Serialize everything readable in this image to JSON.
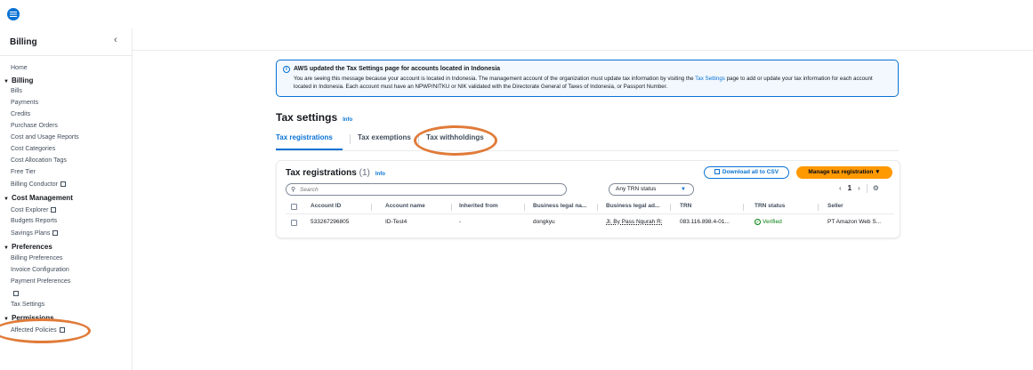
{
  "sidebar": {
    "title": "Billing",
    "collapse_glyph": "‹",
    "items": [
      {
        "key": "home",
        "label": "Home",
        "kind": "item"
      },
      {
        "key": "billing",
        "label": "Billing",
        "kind": "section"
      },
      {
        "key": "bills",
        "label": "Bills",
        "kind": "item"
      },
      {
        "key": "payments",
        "label": "Payments",
        "kind": "item"
      },
      {
        "key": "credits",
        "label": "Credits",
        "kind": "item"
      },
      {
        "key": "purchase-orders",
        "label": "Purchase Orders",
        "kind": "item"
      },
      {
        "key": "cost-usage",
        "label": "Cost and Usage Reports",
        "kind": "item"
      },
      {
        "key": "cost-categories",
        "label": "Cost Categories",
        "kind": "item"
      },
      {
        "key": "cost-allocation",
        "label": "Cost Allocation Tags",
        "kind": "item"
      },
      {
        "key": "free-tier",
        "label": "Free Tier",
        "kind": "item"
      },
      {
        "key": "billing-conductor",
        "label": "Billing Conductor",
        "kind": "item",
        "external": true
      },
      {
        "key": "cost-management",
        "label": "Cost Management",
        "kind": "section"
      },
      {
        "key": "cost-explorer",
        "label": "Cost Explorer",
        "kind": "item",
        "external": true
      },
      {
        "key": "budgets-reports",
        "label": "Budgets Reports",
        "kind": "item"
      },
      {
        "key": "savings-plans",
        "label": "Savings Plans",
        "kind": "item",
        "external": true
      },
      {
        "key": "preferences",
        "label": "Preferences",
        "kind": "section"
      },
      {
        "key": "billing-preferences",
        "label": "Billing Preferences",
        "kind": "item"
      },
      {
        "key": "invoice-config",
        "label": "Invoice Configuration",
        "kind": "item"
      },
      {
        "key": "payment-preferences",
        "label": "Payment Preferences",
        "kind": "item"
      },
      {
        "key": "hidden-item",
        "label": "",
        "kind": "item",
        "external": true
      },
      {
        "key": "tax-settings",
        "label": "Tax Settings",
        "kind": "item"
      },
      {
        "key": "permissions",
        "label": "Permissions",
        "kind": "section"
      },
      {
        "key": "affected-policies",
        "label": "Affected Policies",
        "kind": "item",
        "external": true
      }
    ]
  },
  "flash": {
    "title": "AWS updated the Tax Settings page for accounts located in Indonesia",
    "body_1": "You are seeing this message because your account is located in Indonesia. The management account of the organization must update tax information by visiting the ",
    "body_link": "Tax Settings",
    "body_2": " page to add or update your tax information for each account located in Indonesia. Each account must have an NPWP/NITKU or NIK validated with the Directorate General of Taxes of Indonesia, or Passport Number."
  },
  "page": {
    "title": "Tax settings",
    "info": "Info"
  },
  "tabs": [
    {
      "label": "Tax registrations",
      "active": true
    },
    {
      "label": "Tax exemptions",
      "active": false
    },
    {
      "label": "Tax withholdings",
      "active": false
    }
  ],
  "table": {
    "title": "Tax registrations",
    "count": "(1)",
    "info": "Info",
    "download_label": "Download all to CSV",
    "manage_label": "Manage tax registration ▼",
    "search_placeholder": "Search",
    "filter_value": "Any TRN status",
    "pager": {
      "prev": "‹",
      "page": "1",
      "next": "›",
      "gear": "⚙"
    },
    "headers": [
      "Account ID",
      "Account name",
      "Inherited from",
      "Business legal na...",
      "Business legal ad...",
      "TRN",
      "TRN status",
      "Seller"
    ],
    "rows": [
      [
        "533267296805",
        "ID-Test4",
        "-",
        "dongkyu",
        "Jl. By Pass Ngurah R:",
        "083.116.898.4-01...",
        "Verified",
        "PT Amazon Web S..."
      ]
    ]
  }
}
